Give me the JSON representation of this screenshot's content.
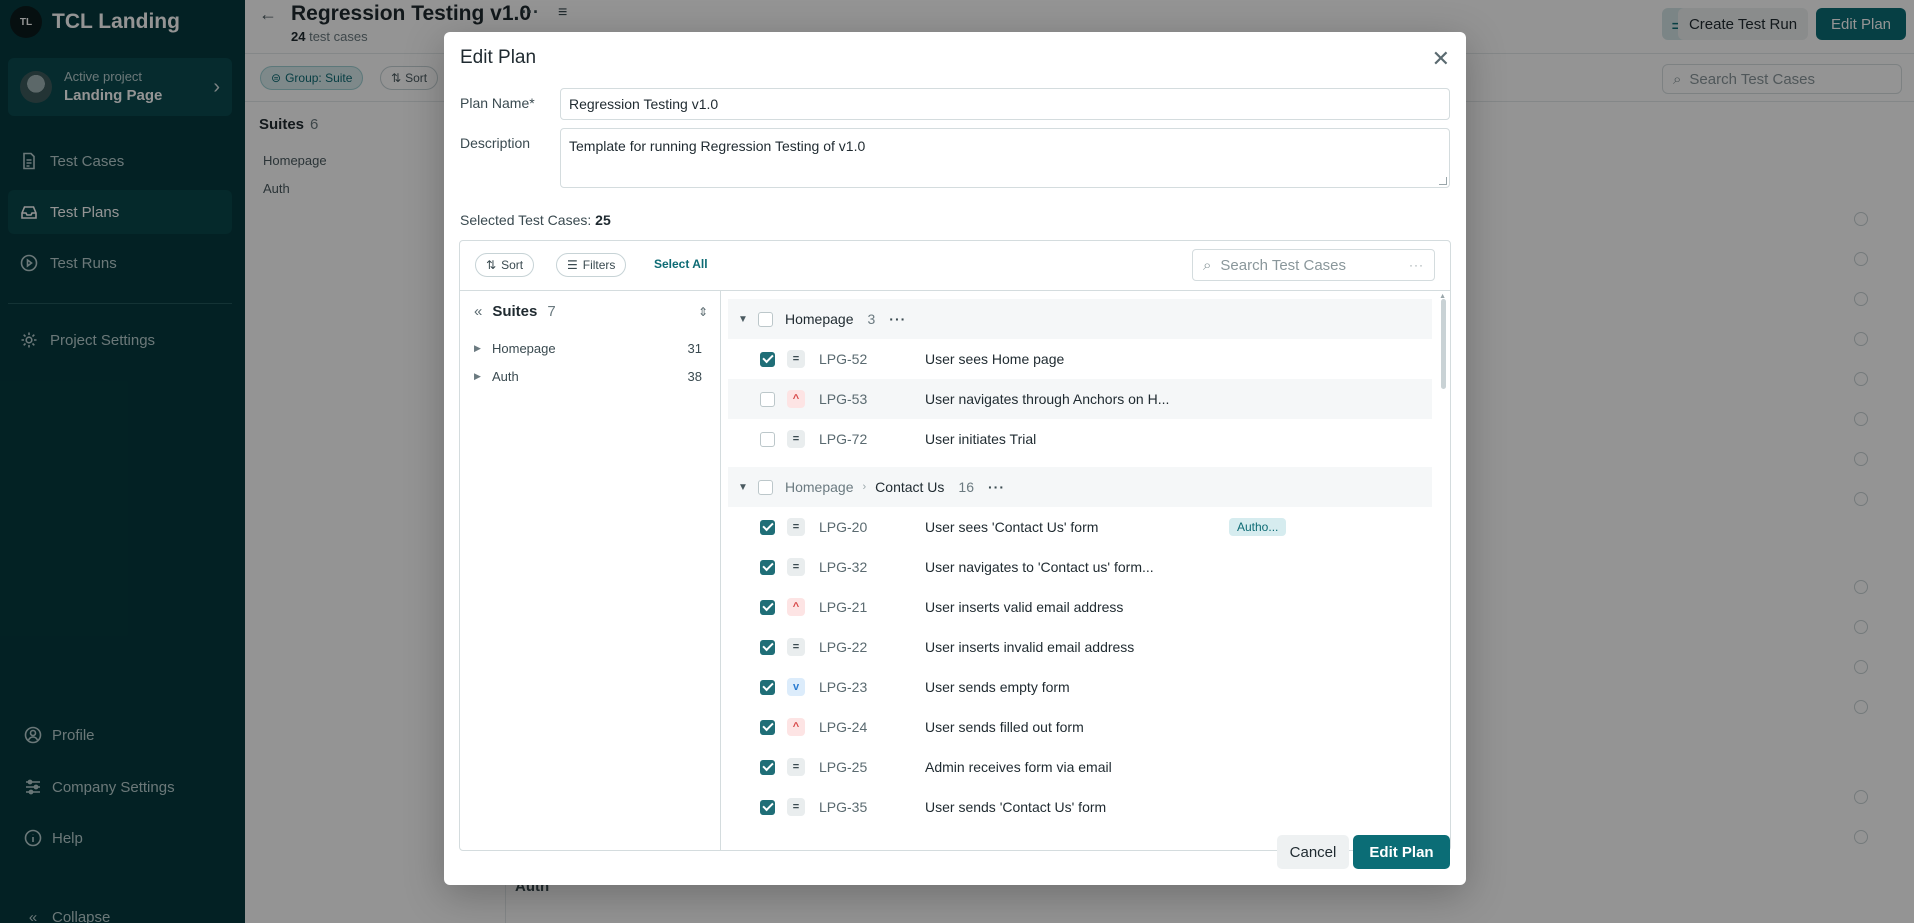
{
  "brand": {
    "badge": "TL",
    "name": "TCL Landing"
  },
  "project": {
    "label": "Active project",
    "name": "Landing Page"
  },
  "nav": [
    {
      "label": "Test Cases",
      "icon": "document-icon"
    },
    {
      "label": "Test Plans",
      "icon": "inbox-icon",
      "active": true
    },
    {
      "label": "Test Runs",
      "icon": "play-circle-icon"
    }
  ],
  "project_settings": "Project Settings",
  "sidebar_bottom": {
    "profile": "Profile",
    "company": "Company Settings",
    "help": "Help",
    "collapse": "Collapse"
  },
  "header": {
    "title": "Regression Testing v1.0",
    "count": "24",
    "count_suffix": "test cases",
    "create_run": "Create Test Run",
    "edit_plan": "Edit Plan"
  },
  "toolbar": {
    "group_chip": "Group: Suite",
    "sort_chip": "Sort",
    "search_placeholder": "Search Test Cases"
  },
  "main_tree": {
    "title": "Suites",
    "count": "6",
    "items": [
      "Homepage",
      "Auth"
    ]
  },
  "ghost_auth": "Auth",
  "modal": {
    "title": "Edit Plan",
    "plan_name_label": "Plan Name*",
    "plan_name_value": "Regression Testing v1.0",
    "description_label": "Description",
    "description_value": "Template for running Regression Testing of v1.0",
    "selected_label": "Selected Test Cases:",
    "selected_count": "25",
    "sort": "Sort",
    "filters": "Filters",
    "select_all": "Select All",
    "search_placeholder": "Search Test Cases",
    "cancel": "Cancel",
    "save": "Edit Plan"
  },
  "suites_tree": {
    "title": "Suites",
    "count": "7",
    "items": [
      {
        "name": "Homepage",
        "count": "31"
      },
      {
        "name": "Auth",
        "count": "38"
      }
    ]
  },
  "groups": [
    {
      "path": "",
      "name": "Homepage",
      "count": "3",
      "cases": [
        {
          "id": "LPG-52",
          "title": "User sees Home page",
          "priority": "normal",
          "checked": true
        },
        {
          "id": "LPG-53",
          "title": "User navigates through Anchors on H...",
          "priority": "high",
          "checked": false
        },
        {
          "id": "LPG-72",
          "title": "User initiates Trial",
          "priority": "normal",
          "checked": false
        }
      ]
    },
    {
      "path": "Homepage",
      "name": "Contact Us",
      "count": "16",
      "cases": [
        {
          "id": "LPG-20",
          "title": "User sees 'Contact Us' form",
          "priority": "normal",
          "checked": true,
          "tag": "Autho..."
        },
        {
          "id": "LPG-32",
          "title": "User navigates to 'Contact us' form...",
          "priority": "normal",
          "checked": true
        },
        {
          "id": "LPG-21",
          "title": "User inserts valid email address",
          "priority": "high",
          "checked": true
        },
        {
          "id": "LPG-22",
          "title": "User inserts invalid email address",
          "priority": "normal",
          "checked": true
        },
        {
          "id": "LPG-23",
          "title": "User sends empty form",
          "priority": "low",
          "checked": true
        },
        {
          "id": "LPG-24",
          "title": "User sends filled out form",
          "priority": "high",
          "checked": true
        },
        {
          "id": "LPG-25",
          "title": "Admin receives form via email",
          "priority": "normal",
          "checked": true
        },
        {
          "id": "LPG-35",
          "title": "User sends 'Contact Us' form",
          "priority": "normal",
          "checked": true
        }
      ]
    }
  ]
}
